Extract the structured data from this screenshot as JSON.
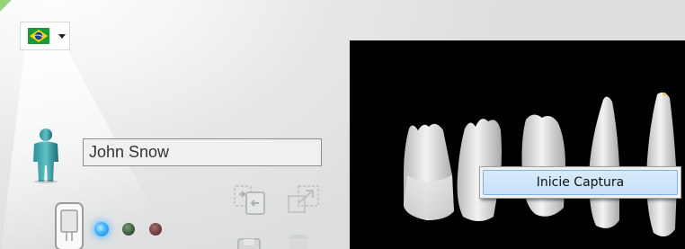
{
  "window": {
    "language_selector": {
      "flag": "brazil-flag-icon",
      "arrow": "chevron-down-icon"
    }
  },
  "patient": {
    "name": "John Snow",
    "icon": "user-icon"
  },
  "device": {
    "icon": "sensor-device-icon",
    "status_lights": [
      {
        "name": "blue",
        "color": "#3db3ff",
        "active": true
      },
      {
        "name": "green",
        "color": "#3b5a3b",
        "active": false
      },
      {
        "name": "red",
        "color": "#6e3c3c",
        "active": false
      }
    ]
  },
  "toolbar": {
    "icons": [
      "swap-images-icon",
      "expand-icon",
      "save-icon",
      "database-icon"
    ]
  },
  "viewer": {
    "background": "#000000"
  },
  "context_menu": {
    "items": [
      {
        "label": "Inicie Captura"
      }
    ]
  }
}
